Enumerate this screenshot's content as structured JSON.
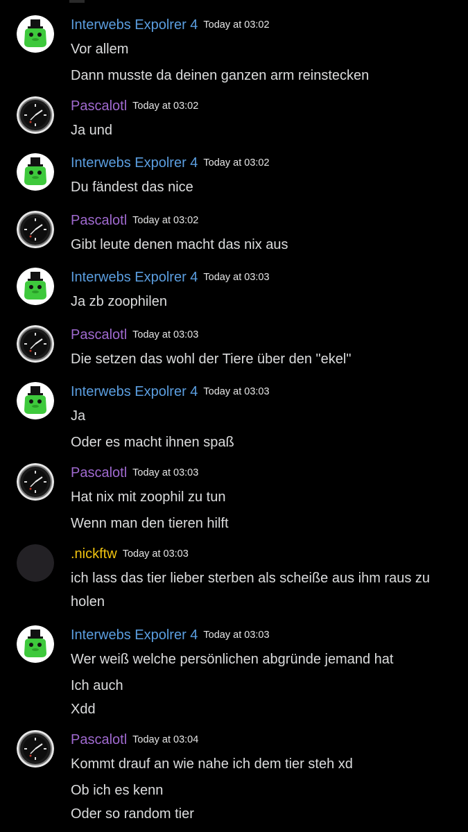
{
  "colors": {
    "background": "#000000",
    "message_text": "#dcddde",
    "timestamp": "#e6e6e6",
    "user_interwebs": "#5b9ee0",
    "user_pascalotl": "#a06ad0",
    "user_nickftw": "#f1c40f"
  },
  "users": {
    "interwebs": {
      "name": "Interwebs Expolrer 4",
      "avatar_icon": "green-blob-top-hat-icon"
    },
    "pascalotl": {
      "name": "Pascalotl",
      "avatar_icon": "watch-face-icon"
    },
    "nickftw": {
      "name": ".nickftw",
      "avatar_icon": "default-avatar-icon"
    }
  },
  "messages": [
    {
      "user": "Interwebs Expolrer 4",
      "time": "Today at 03:02",
      "lines": [
        "Vor allem",
        "Dann musste da deinen ganzen arm reinstecken"
      ]
    },
    {
      "user": "Pascalotl",
      "time": "Today at 03:02",
      "lines": [
        "Ja und"
      ]
    },
    {
      "user": "Interwebs Expolrer 4",
      "time": "Today at 03:02",
      "lines": [
        "Du fändest das nice"
      ]
    },
    {
      "user": "Pascalotl",
      "time": "Today at 03:02",
      "lines": [
        "Gibt leute denen macht das nix aus"
      ]
    },
    {
      "user": "Interwebs Expolrer 4",
      "time": "Today at 03:03",
      "lines": [
        "Ja zb zoophilen"
      ]
    },
    {
      "user": "Pascalotl",
      "time": "Today at 03:03",
      "lines": [
        "Die setzen das wohl der Tiere über den \"ekel\""
      ]
    },
    {
      "user": "Interwebs Expolrer 4",
      "time": "Today at 03:03",
      "lines": [
        "Ja",
        "Oder es macht ihnen spaß"
      ]
    },
    {
      "user": "Pascalotl",
      "time": "Today at 03:03",
      "lines": [
        "Hat nix mit zoophil zu tun",
        "Wenn man den tieren hilft"
      ]
    },
    {
      "user": ".nickftw",
      "time": "Today at 03:03",
      "lines": [
        "ich lass das tier lieber sterben als scheiße aus ihm raus zu holen"
      ]
    },
    {
      "user": "Interwebs Expolrer 4",
      "time": "Today at 03:03",
      "lines": [
        "Wer weiß welche persönlichen abgründe jemand hat",
        "Ich auch",
        "Xdd"
      ]
    },
    {
      "user": "Pascalotl",
      "time": "Today at 03:04",
      "lines": [
        "Kommt drauf an wie nahe ich dem tier steh xd",
        "Ob ich es kenn",
        "Oder so random tier"
      ]
    }
  ]
}
